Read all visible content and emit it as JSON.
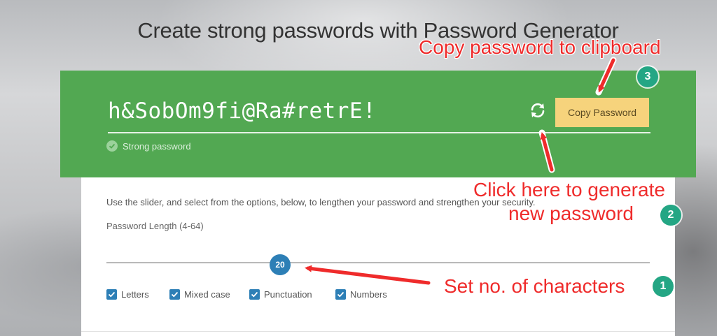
{
  "page": {
    "title": "Create strong passwords with Password Generator"
  },
  "generator": {
    "password": "h&SobOm9fi@Ra#retrE!",
    "copy_button_label": "Copy Password",
    "refresh_icon": "refresh-icon",
    "strength_label": "Strong password",
    "strength_icon": "check-circle-icon",
    "panel_color": "#52a852",
    "copy_button_color": "#f6d37c"
  },
  "options": {
    "instructions": "Use the slider, and select from the options, below, to lengthen your password and strengthen your security.",
    "length_label": "Password Length (4-64)",
    "length_value": "20",
    "length_min": 4,
    "length_max": 64,
    "checkboxes": [
      {
        "label": "Letters",
        "checked": true
      },
      {
        "label": "Mixed case",
        "checked": true
      },
      {
        "label": "Punctuation",
        "checked": true
      },
      {
        "label": "Numbers",
        "checked": true
      }
    ],
    "accent_color": "#2d7fb6"
  },
  "annotations": {
    "copy_note": "Copy password to clipboard",
    "refresh_note_line1": "Click here to generate",
    "refresh_note_line2": "new password",
    "slider_note": "Set no. of characters",
    "badge_1": "1",
    "badge_2": "2",
    "badge_3": "3",
    "annotation_color": "#ef2b2b",
    "badge_color": "#24a684"
  }
}
